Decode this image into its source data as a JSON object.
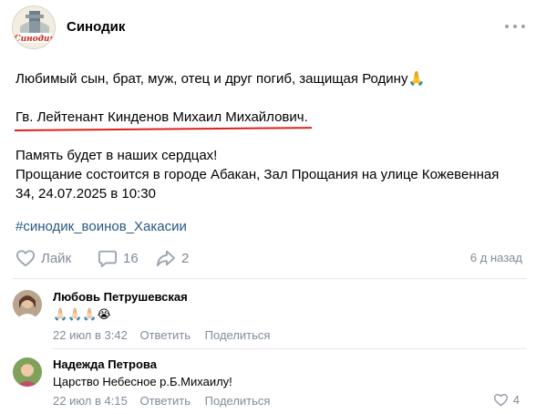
{
  "post": {
    "author": "Синодик",
    "logo_text": "Синодик",
    "lines": [
      "Любимый сын, брат, муж, отец и друг погиб, защищая Родину🙏",
      "Гв. Лейтенант Кинденов Михаил Михайлович.",
      "Память будет в наших сердцах!",
      "Прощание состоится в городе Абакан, Зал Прощания на улице Кожевенная",
      "34, 24.07.2025 в 10:30"
    ],
    "hashtag": "#синодик_воинов_Хакасии",
    "like_label": "Лайк",
    "comments_count": "16",
    "shares_count": "2",
    "time": "6 д назад"
  },
  "comments": [
    {
      "author": "Любовь Петрушевская",
      "text": "🙏🏻🙏🏻🙏🏻😭",
      "date": "22 июл в 3:42",
      "reply_label": "Ответить",
      "share_label": "Поделиться"
    },
    {
      "author": "Надежда Петрова",
      "text": "Царство Небесное р.Б.Михаилу!",
      "date": "22 июл в 4:15",
      "reply_label": "Ответить",
      "share_label": "Поделиться",
      "likes": "4"
    }
  ],
  "colors": {
    "accent": "#2a5885",
    "muted": "#818c99",
    "underline": "#e0201b",
    "divider": "#e7e8ec",
    "logo_red": "#c8281e"
  },
  "icons": [
    "more-icon",
    "heart-icon",
    "comment-icon",
    "share-icon"
  ]
}
